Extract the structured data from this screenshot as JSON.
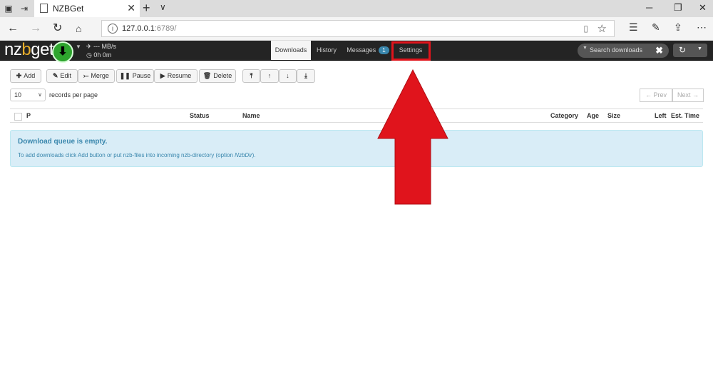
{
  "browser": {
    "tab_title": "NZBGet",
    "url_host": "127.0.0.1",
    "url_port": ":6789/"
  },
  "app": {
    "logo_pre": "nz",
    "logo_b": "b",
    "logo_post": "get",
    "speed": "--- MB/s",
    "time": "0h 0m",
    "nav": {
      "downloads": "Downloads",
      "history": "History",
      "messages": "Messages",
      "messages_count": "1",
      "settings": "Settings"
    },
    "search_placeholder": "Search downloads"
  },
  "toolbar": {
    "add": "Add",
    "edit": "Edit",
    "merge": "Merge",
    "pause": "Pause",
    "resume": "Resume",
    "delete": "Delete"
  },
  "paging": {
    "records_value": "10",
    "records_label": "records per page",
    "prev": "← Prev",
    "next": "Next →"
  },
  "table": {
    "headers": {
      "p": "P",
      "status": "Status",
      "name": "Name",
      "category": "Category",
      "age": "Age",
      "size": "Size",
      "left": "Left",
      "est": "Est. Time"
    }
  },
  "empty": {
    "heading": "Download queue is empty.",
    "text_pre": "To add downloads click Add button or put nzb-files into incoming nzb-directory (option ",
    "text_opt": "NzbDir",
    "text_post": ")."
  },
  "colors": {
    "highlight": "#e0141c",
    "info_bg": "#d9edf7",
    "info_text": "#3a87ad",
    "appbar": "#242424"
  }
}
